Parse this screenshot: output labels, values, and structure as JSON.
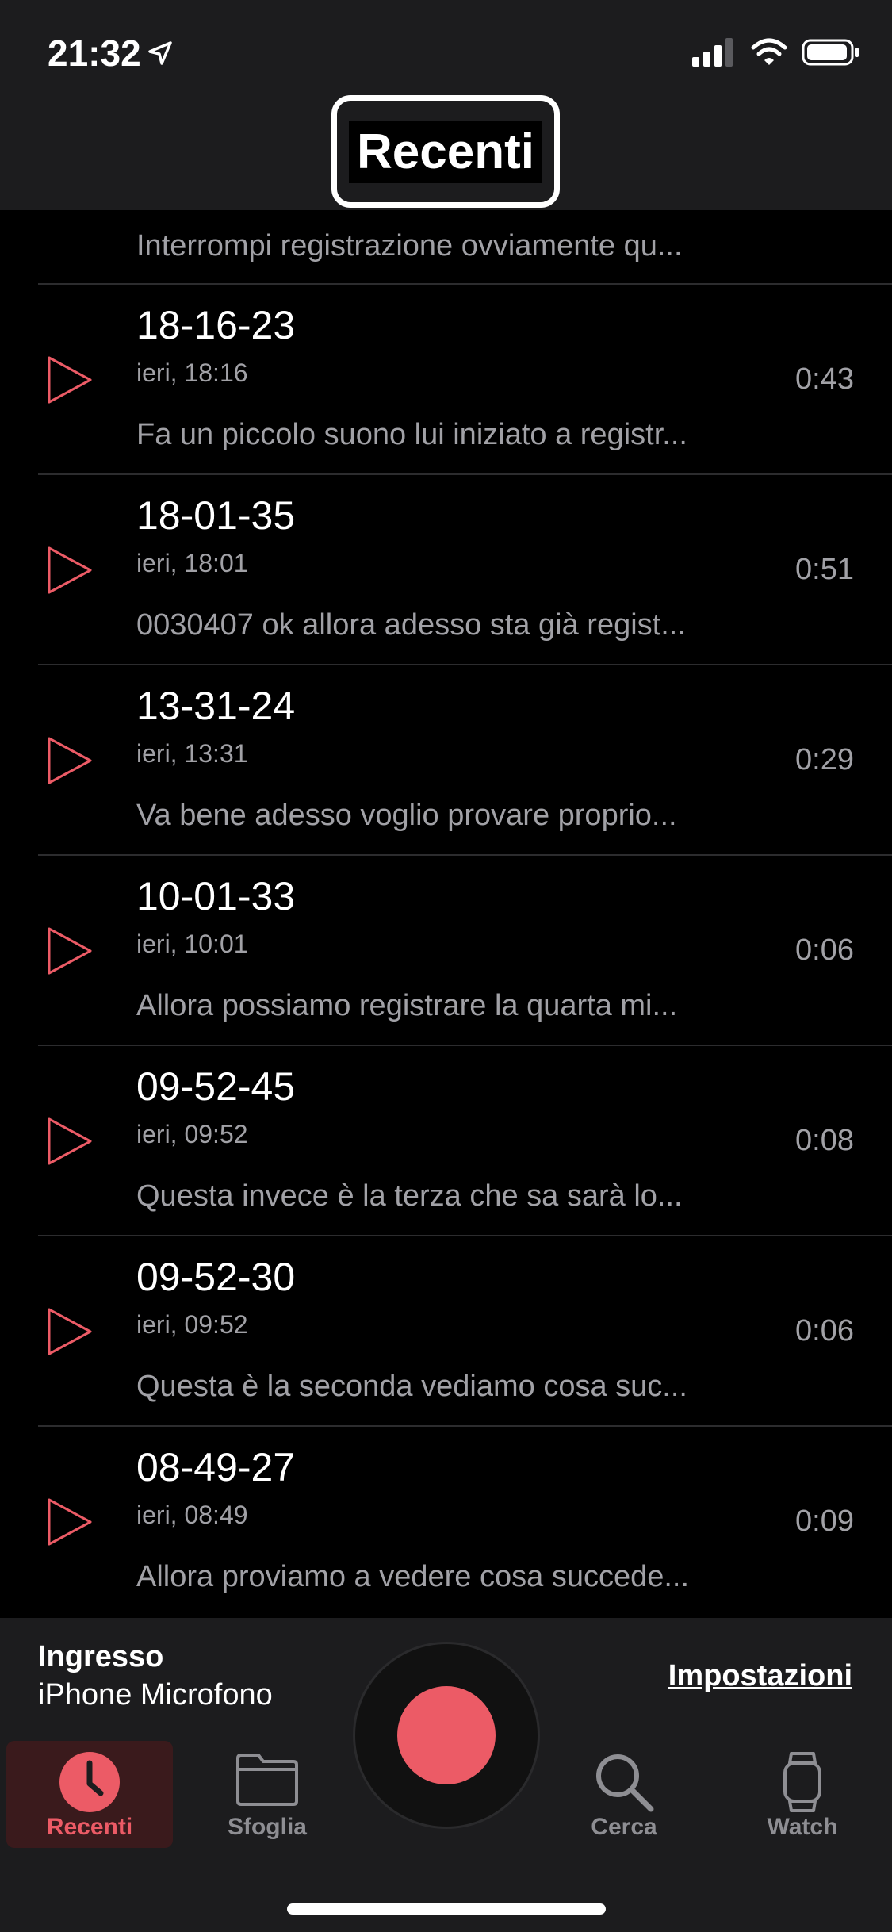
{
  "status_bar": {
    "time": "21:32"
  },
  "header": {
    "title": "Recenti"
  },
  "partial_row": {
    "transcript": "Interrompi registrazione ovviamente qu..."
  },
  "recordings": [
    {
      "title": "18-16-23",
      "date": "ieri, 18:16",
      "duration": "0:43",
      "transcript": "Fa un piccolo suono lui iniziato a registr..."
    },
    {
      "title": "18-01-35",
      "date": "ieri, 18:01",
      "duration": "0:51",
      "transcript": "0030407 ok allora adesso sta già regist..."
    },
    {
      "title": "13-31-24",
      "date": "ieri, 13:31",
      "duration": "0:29",
      "transcript": "Va bene adesso voglio provare proprio..."
    },
    {
      "title": "10-01-33",
      "date": "ieri, 10:01",
      "duration": "0:06",
      "transcript": "Allora possiamo registrare la quarta mi..."
    },
    {
      "title": "09-52-45",
      "date": "ieri, 09:52",
      "duration": "0:08",
      "transcript": "Questa invece è la terza che sa sarà lo..."
    },
    {
      "title": "09-52-30",
      "date": "ieri, 09:52",
      "duration": "0:06",
      "transcript": "Questa è la seconda vediamo cosa suc..."
    },
    {
      "title": "08-49-27",
      "date": "ieri, 08:49",
      "duration": "0:09",
      "transcript": "Allora proviamo a vedere cosa succede..."
    }
  ],
  "input": {
    "label": "Ingresso",
    "value": "iPhone Microfono",
    "settings_link": "Impostazioni"
  },
  "tabs": [
    {
      "label": "Recenti",
      "icon": "clock-icon",
      "active": true
    },
    {
      "label": "Sfoglia",
      "icon": "folder-icon",
      "active": false
    },
    {
      "label": "Cerca",
      "icon": "magnifier-icon",
      "active": false
    },
    {
      "label": "Watch",
      "icon": "watch-icon",
      "active": false
    }
  ],
  "colors": {
    "accent": "#ec5b66",
    "background": "#000000",
    "panel": "#1c1c1e",
    "secondary_text": "#a1a1a6"
  }
}
